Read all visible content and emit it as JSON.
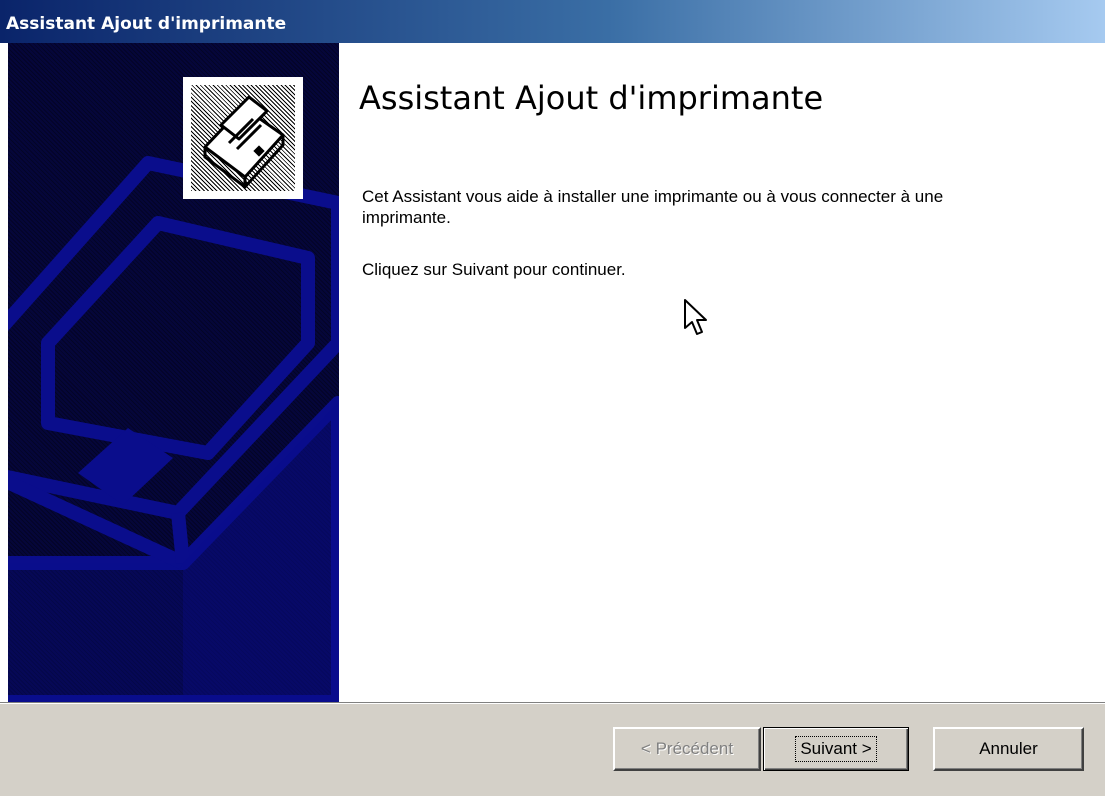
{
  "window": {
    "title": "Assistant Ajout d'imprimante"
  },
  "wizard": {
    "heading": "Assistant Ajout d'imprimante",
    "paragraph1": "Cet Assistant vous aide à installer une imprimante ou à vous connecter à une imprimante.",
    "paragraph2": "Cliquez sur Suivant pour continuer.",
    "icon": "printer-icon"
  },
  "buttons": {
    "previous": "< Précédent",
    "next": "Suivant >",
    "cancel": "Annuler"
  },
  "colors": {
    "titlebar_start": "#0a246a",
    "titlebar_end": "#a6caf0",
    "side_panel": "#05063a",
    "dialog_face": "#d4d0c8"
  }
}
